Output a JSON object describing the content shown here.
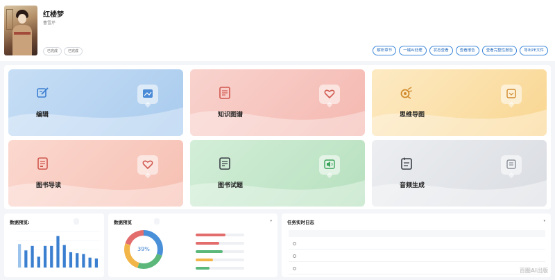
{
  "book": {
    "title": "红楼梦",
    "author": "曹雪芹",
    "tags": [
      "已完成",
      "已完成"
    ]
  },
  "actions": [
    "解析章节",
    "一键AI处理",
    "状态查看",
    "查看报告",
    "查看完整性报告",
    "导出PE文件"
  ],
  "cards": [
    {
      "title": "编辑",
      "icon": "edit-icon",
      "desc": "",
      "color": "#bcd7f2"
    },
    {
      "title": "知识图谱",
      "icon": "knowledge-graph-icon",
      "desc": "",
      "color": "#f6c7c1"
    },
    {
      "title": "思维导图",
      "icon": "mind-map-icon",
      "desc": "",
      "color": "#fbe3b4"
    },
    {
      "title": "图书导读",
      "icon": "book-guide-icon",
      "desc": "",
      "color": "#f8cfc6"
    },
    {
      "title": "图书试题",
      "icon": "quiz-icon",
      "desc": "",
      "color": "#c6e8cd"
    },
    {
      "title": "音频生成",
      "icon": "audio-icon",
      "desc": "",
      "color": "#e2e4e8"
    }
  ],
  "panel_overview": {
    "title": "数据预览:",
    "select": ""
  },
  "panel_stats": {
    "title": "数据预览",
    "select": "",
    "donut_label": "39%"
  },
  "panel_log": {
    "title": "任务实时日志"
  },
  "chart_data": {
    "type": "bar",
    "values": [
      52,
      38,
      48,
      24,
      48,
      48,
      70,
      50,
      34,
      32,
      30,
      22,
      20
    ],
    "series_colors": [
      "#9cc3ec",
      "#3b7fd0"
    ]
  },
  "progress": [
    {
      "value": 0.62,
      "color": "#e36d6d"
    },
    {
      "value": 0.48,
      "color": "#e36d6d"
    },
    {
      "value": 0.55,
      "color": "#5cb87a"
    },
    {
      "value": 0.35,
      "color": "#f2b548"
    },
    {
      "value": 0.28,
      "color": "#5cb87a"
    }
  ],
  "donut": [
    {
      "value": 0.3,
      "color": "#4a90d9"
    },
    {
      "value": 0.25,
      "color": "#5cb87a"
    },
    {
      "value": 0.25,
      "color": "#f2b548"
    },
    {
      "value": 0.2,
      "color": "#e36d6d"
    }
  ],
  "watermark": "百图AI出版"
}
